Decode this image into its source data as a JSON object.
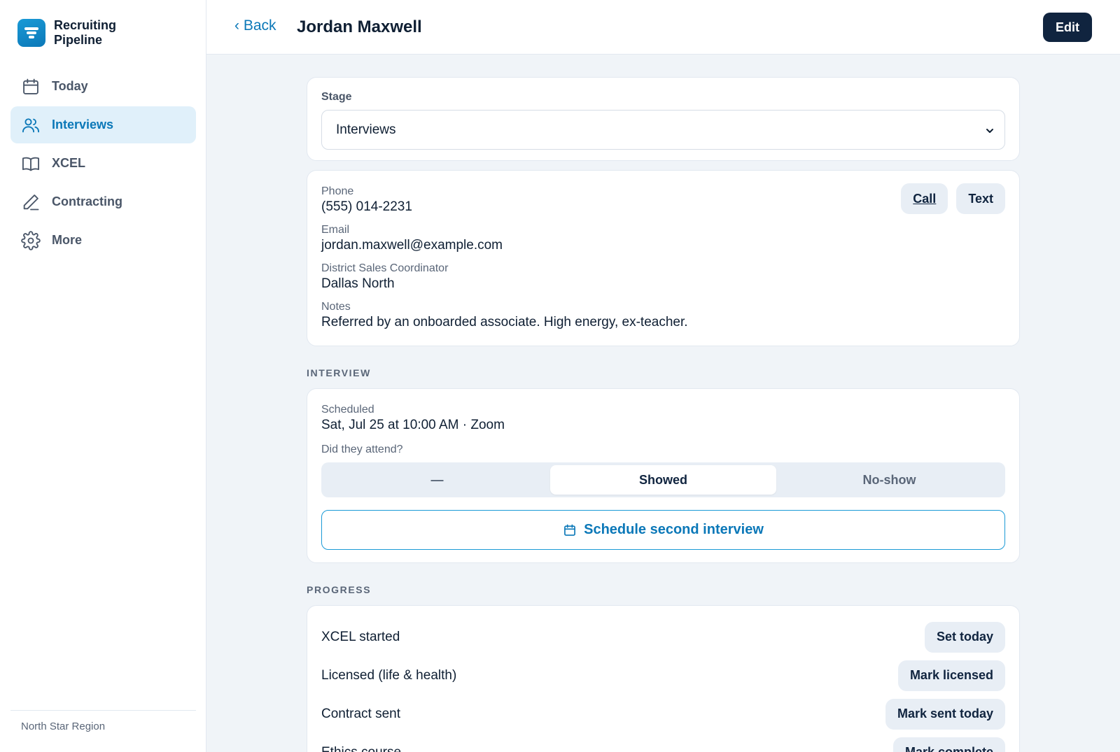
{
  "sidebar": {
    "brand": "Recruiting Pipeline",
    "items": [
      {
        "label": "Today",
        "icon": "calendar-icon"
      },
      {
        "label": "Interviews",
        "icon": "users-icon"
      },
      {
        "label": "XCEL",
        "icon": "book-icon"
      },
      {
        "label": "Contracting",
        "icon": "pen-icon"
      },
      {
        "label": "More",
        "icon": "gear-icon"
      }
    ],
    "footer": "North Star Region"
  },
  "header": {
    "back": "‹ Back",
    "title": "Jordan Maxwell",
    "edit": "Edit"
  },
  "stage": {
    "label": "Stage",
    "value": "Interviews"
  },
  "contact": {
    "phone_label": "Phone",
    "phone": "(555) 014-2231",
    "email_label": "Email",
    "email": "jordan.maxwell@example.com",
    "dsc_label": "District Sales Coordinator",
    "dsc": "Dallas North",
    "notes_label": "Notes",
    "notes": "Referred by an onboarded associate. High energy, ex-teacher.",
    "call": "Call",
    "text": "Text"
  },
  "interview": {
    "section": "INTERVIEW",
    "scheduled_label": "Scheduled",
    "scheduled": "Sat, Jul 25 at 10:00 AM · Zoom",
    "attend_label": "Did they attend?",
    "options": [
      "—",
      "Showed",
      "No-show"
    ],
    "selected": "Showed",
    "schedule_second": "Schedule second interview"
  },
  "progress": {
    "section": "PROGRESS",
    "rows": [
      {
        "name": "XCEL started",
        "action": "Set today"
      },
      {
        "name": "Licensed (life & health)",
        "action": "Mark licensed"
      },
      {
        "name": "Contract sent",
        "action": "Mark sent today"
      },
      {
        "name": "Ethics course",
        "action": "Mark complete"
      }
    ]
  },
  "colors": {
    "accent": "#0b78b8",
    "dark": "#10243f",
    "background": "#f0f4f8"
  }
}
